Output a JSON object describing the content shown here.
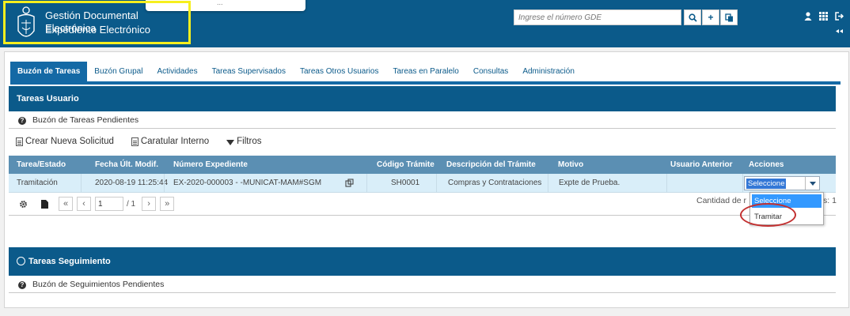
{
  "header": {
    "title": "Gestión Documental Electrónica",
    "subtitle": "Expediente Electrónico",
    "search_placeholder": "Ingrese el número GDE",
    "popup_text": "...",
    "icons": [
      "search-icon",
      "plus-icon",
      "copy-icon",
      "user-icon",
      "grid-icon",
      "logout-icon"
    ],
    "brand_color": "#0b5a8a",
    "highlight_color": "#f6ef1d"
  },
  "tabs": [
    {
      "label": "Buzón de Tareas",
      "active": true
    },
    {
      "label": "Buzón Grupal",
      "active": false
    },
    {
      "label": "Actividades",
      "active": false
    },
    {
      "label": "Tareas Supervisados",
      "active": false
    },
    {
      "label": "Tareas Otros Usuarios",
      "active": false
    },
    {
      "label": "Tareas en Paralelo",
      "active": false
    },
    {
      "label": "Consultas",
      "active": false
    },
    {
      "label": "Administración",
      "active": false
    }
  ],
  "tareas_usuario": {
    "title": "Tareas Usuario",
    "subtitle": "Buzón de Tareas Pendientes",
    "actions": {
      "crear": "Crear Nueva Solicitud",
      "caratular": "Caratular Interno",
      "filtros": "Filtros"
    },
    "columns": [
      "Tarea/Estado",
      "Fecha Últ. Modif.",
      "Número Expediente",
      "Código Trámite",
      "Descripción del Trámite",
      "Motivo",
      "Usuario Anterior",
      "Acciones"
    ],
    "row": {
      "tarea": "Tramitación",
      "fecha": "2020-08-19 11:25:44",
      "expediente": "EX-2020-000003   - -MUNICAT-MAM#SGM",
      "codigo": "SH0001",
      "descripcion": "Compras y Contrataciones",
      "motivo": "Expte de Prueba.",
      "usuario_anterior": "",
      "accion_selected": "Seleccione"
    },
    "pager": {
      "page": "1",
      "of": "/ 1",
      "count_label": "Cantidad de r",
      "count_tail": "s: 1"
    },
    "dropdown_options": [
      "Seleccione",
      "Tramitar"
    ]
  },
  "tareas_seguimiento": {
    "title": "Tareas Seguimiento",
    "subtitle": "Buzón de Seguimientos Pendientes"
  },
  "annotation_color": "#c23030"
}
